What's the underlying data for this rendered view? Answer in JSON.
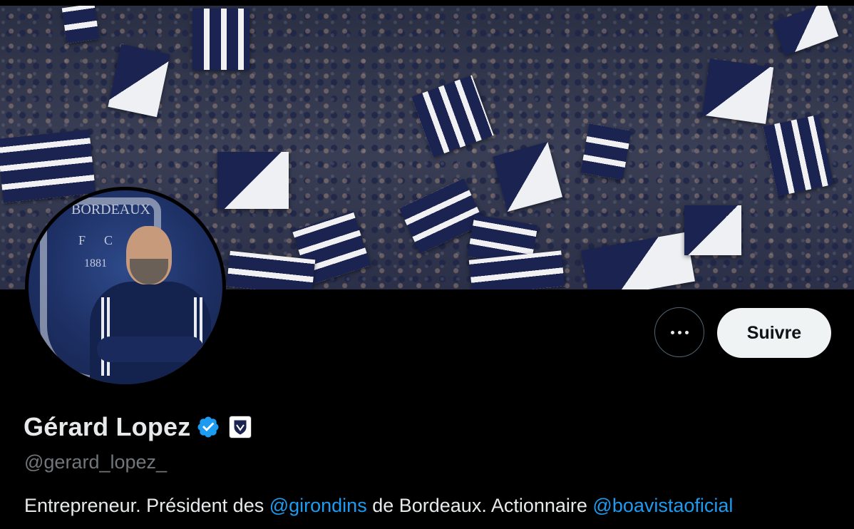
{
  "profile": {
    "name": "Gérard Lopez",
    "handle": "@gerard_lopez_",
    "verified": true,
    "affiliation_icon": "girondins-crest-icon",
    "bio": {
      "part1": "Entrepreneur. Président des ",
      "mention1": "@girondins",
      "part2": " de Bordeaux. Actionnaire ",
      "mention2": "@boavistaoficial"
    }
  },
  "avatar": {
    "crest_text": "BORDEAUX",
    "crest_fc": "FC",
    "crest_year": "1881"
  },
  "actions": {
    "follow_label": "Suivre",
    "more_icon": "more-horizontal-icon"
  },
  "colors": {
    "background": "#000000",
    "accent_link": "#1d9bf0",
    "verified": "#1d9bf0",
    "follow_button_bg": "#eff3f4"
  }
}
